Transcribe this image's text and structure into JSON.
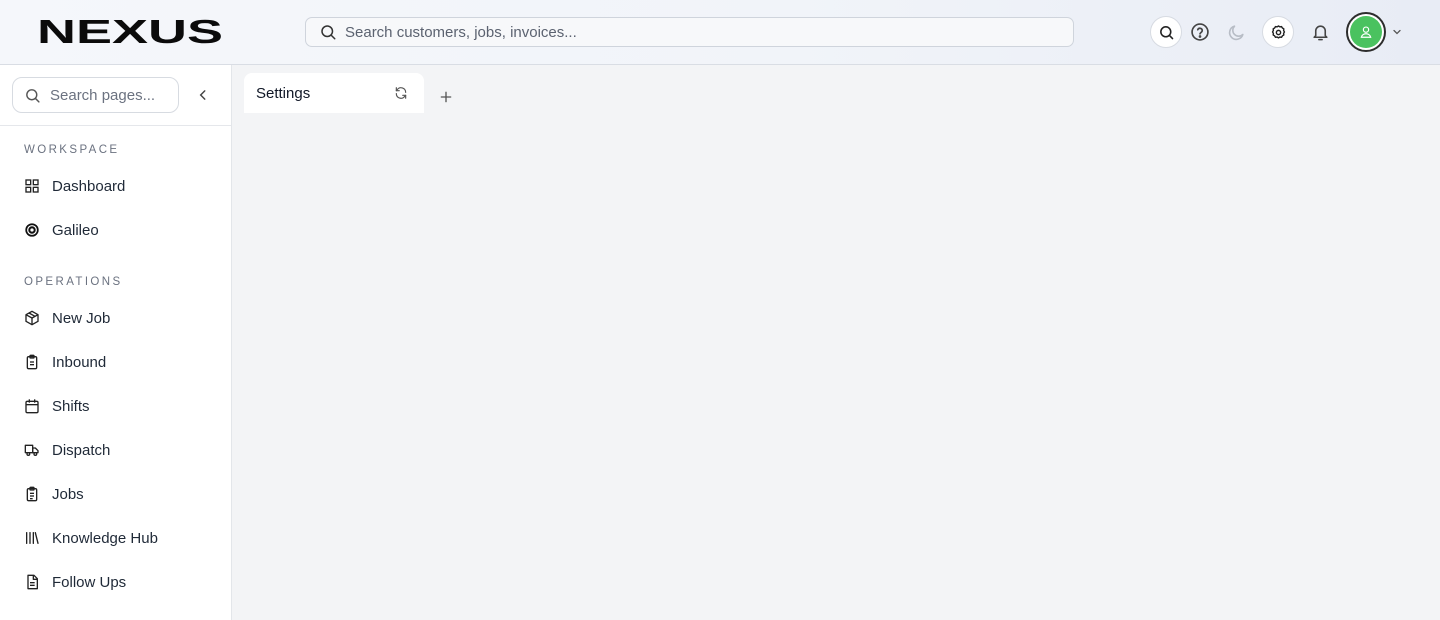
{
  "app": {
    "logo_text": "NEXUS"
  },
  "header": {
    "search_placeholder": "Search customers, jobs, invoices...",
    "icons": [
      "search-icon",
      "help-icon",
      "moon-icon",
      "settings-icon",
      "bell-icon",
      "user-icon",
      "chevron-down-icon"
    ]
  },
  "sidebar": {
    "search_placeholder": "Search pages...",
    "sections": [
      {
        "label": "WORKSPACE"
      },
      {
        "label": "OPERATIONS"
      }
    ],
    "items": [
      {
        "label": "Dashboard",
        "icon": "dashboard-grid-icon"
      },
      {
        "label": "Galileo",
        "icon": "galileo-icon"
      },
      {
        "label": "New Job",
        "icon": "package-plus-icon"
      },
      {
        "label": "Inbound",
        "icon": "clipboard-icon"
      },
      {
        "label": "Shifts",
        "icon": "calendar-icon"
      },
      {
        "label": "Dispatch",
        "icon": "truck-icon"
      },
      {
        "label": "Jobs",
        "icon": "clipboard-list-icon"
      },
      {
        "label": "Knowledge Hub",
        "icon": "library-icon"
      },
      {
        "label": "Follow Ups",
        "icon": "file-text-icon"
      }
    ]
  },
  "tabs": [
    {
      "label": "Settings",
      "active": true
    }
  ],
  "colors": {
    "avatar": "#4ac25f",
    "logo": "#0b0b0b"
  }
}
